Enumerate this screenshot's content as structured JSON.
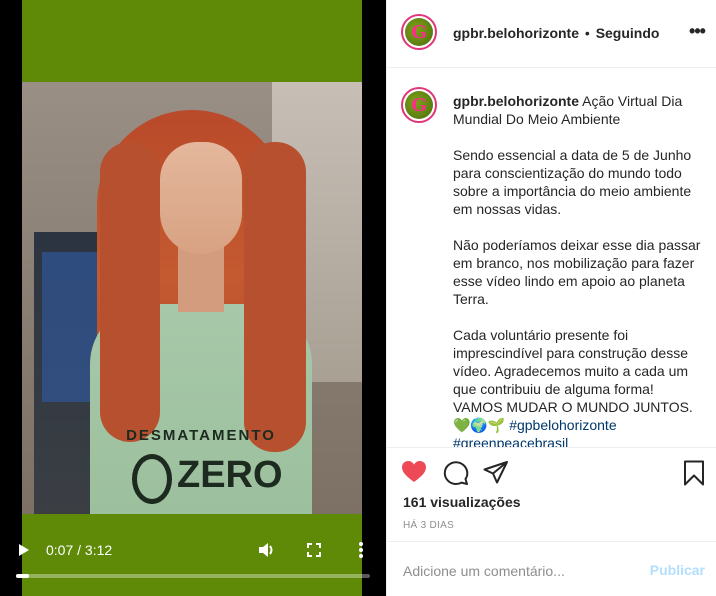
{
  "video": {
    "current_time": "0:07",
    "duration": "3:12",
    "time_separator": " / ",
    "progress_fraction": 0.036,
    "shirt_text": "DESMATAMENTO",
    "shirt_letters": "ZERO"
  },
  "post": {
    "username": "gpbr.belohorizonte",
    "separator": "•",
    "follow_status": "Seguindo",
    "avatar_letter": "G",
    "caption_title": " Ação Virtual Dia Mundial Do Meio Ambiente",
    "caption_body": "Sendo essencial a data de 5 de Junho para conscientização do mundo todo sobre a importância do meio ambiente em nossas vidas.\n\nNão poderíamos deixar esse dia passar em branco, nos mobilização para fazer esse vídeo lindo em apoio ao planeta Terra.\n\nCada voluntário presente foi imprescindível para construção desse vídeo. Agradecemos muito a cada um que contribuiu de alguma forma!\nVAMOS MUDAR O MUNDO JUNTOS.\n💚🌍🌱 ",
    "hashtags": [
      "#gpbelohorizonte",
      "#greenpeacebrasil"
    ],
    "views": "161 visualizações",
    "time_ago": "HÁ 3 DIAS"
  },
  "comment": {
    "placeholder": "Adicione um comentário...",
    "publish_label": "Publicar"
  },
  "colors": {
    "like_red": "#ed4956",
    "link_blue": "#00376b",
    "publish_disabled": "#b2dffc",
    "video_bg_green": "#5e8a08"
  }
}
